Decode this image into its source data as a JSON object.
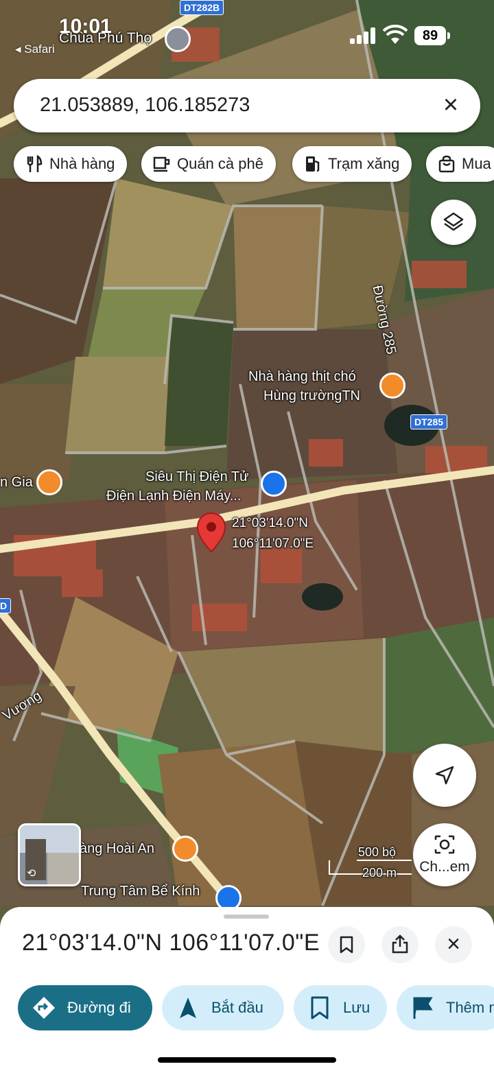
{
  "status": {
    "time": "10:01",
    "back_app": "◂ Safari",
    "battery": "89"
  },
  "search": {
    "value": "21.053889, 106.185273",
    "close_icon": "close-icon"
  },
  "chips": [
    {
      "label": "Nhà hàng",
      "icon": "restaurant-icon"
    },
    {
      "label": "Quán cà phê",
      "icon": "coffee-icon"
    },
    {
      "label": "Trạm xăng",
      "icon": "gas-station-icon"
    },
    {
      "label": "Mua",
      "icon": "shopping-bag-icon"
    }
  ],
  "map": {
    "labels": {
      "top_place": "Chùa Phú Thọ",
      "road_shield_top": "DT282B",
      "road_285": "Đường 285",
      "road_shield_285": "DT285",
      "restaurant_1_line1": "Nhà hàng thịt chó",
      "restaurant_1_line2": "Hùng trườngTN",
      "left_place": "n Gia",
      "supermarket_line1": "Siêu Thị Điện Tử",
      "supermarket_line2": "Điện Lạnh Điện Máy...",
      "pin_lat": "21°03'14.0\"N",
      "pin_lng": "106°11'07.0\"E",
      "road_vuong": "Vương",
      "hoai_an": "àng Hoài An",
      "be_kinh": "Trung Tâm Bể Kính",
      "shield_left": "D"
    },
    "scale": {
      "top": "500 bộ",
      "bottom": "200 m"
    },
    "streetview_label": "Ch...em"
  },
  "sheet": {
    "title": "21°03'14.0\"N 106°11'07.0\"E",
    "actions": [
      {
        "label": "Đường đi",
        "icon": "directions-icon"
      },
      {
        "label": "Bắt đầu",
        "icon": "navigation-icon"
      },
      {
        "label": "Lưu",
        "icon": "bookmark-icon"
      },
      {
        "label": "Thêm n",
        "icon": "flag-icon"
      }
    ]
  },
  "colors": {
    "accent": "#1a6f86",
    "action_bg": "#d3eefa",
    "pin": "#e53935"
  }
}
